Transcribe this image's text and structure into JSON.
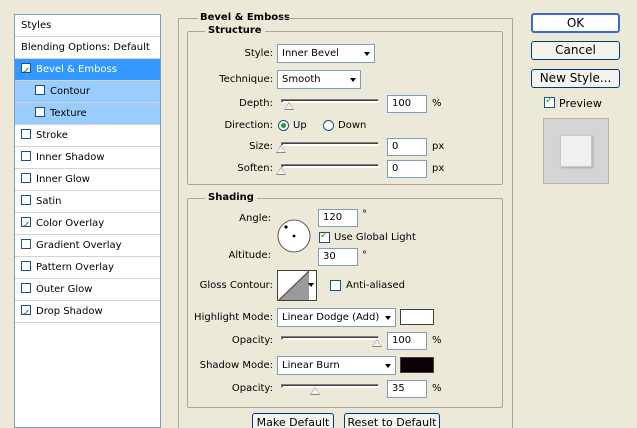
{
  "styles_panel": {
    "header": "Styles",
    "blending_options": "Blending Options: Default",
    "items": [
      {
        "label": "Bevel & Emboss",
        "checked": true,
        "selected": true,
        "sub": false
      },
      {
        "label": "Contour",
        "checked": false,
        "selected": false,
        "sub": true
      },
      {
        "label": "Texture",
        "checked": false,
        "selected": false,
        "sub": true
      },
      {
        "label": "Stroke",
        "checked": false,
        "selected": false,
        "sub": false
      },
      {
        "label": "Inner Shadow",
        "checked": false,
        "selected": false,
        "sub": false
      },
      {
        "label": "Inner Glow",
        "checked": false,
        "selected": false,
        "sub": false
      },
      {
        "label": "Satin",
        "checked": false,
        "selected": false,
        "sub": false
      },
      {
        "label": "Color Overlay",
        "checked": true,
        "selected": false,
        "sub": false
      },
      {
        "label": "Gradient Overlay",
        "checked": false,
        "selected": false,
        "sub": false
      },
      {
        "label": "Pattern Overlay",
        "checked": false,
        "selected": false,
        "sub": false
      },
      {
        "label": "Outer Glow",
        "checked": false,
        "selected": false,
        "sub": false
      },
      {
        "label": "Drop Shadow",
        "checked": true,
        "selected": false,
        "sub": false
      }
    ]
  },
  "bevel": {
    "title": "Bevel & Emboss",
    "structure": {
      "title": "Structure",
      "style_label": "Style:",
      "style_value": "Inner Bevel",
      "technique_label": "Technique:",
      "technique_value": "Smooth",
      "depth_label": "Depth:",
      "depth_value": "100",
      "depth_unit": "%",
      "depth_slider": 0.08,
      "direction_label": "Direction:",
      "direction_up": "Up",
      "direction_down": "Down",
      "direction_selected": "Up",
      "size_label": "Size:",
      "size_value": "0",
      "size_unit": "px",
      "size_slider": 0.0,
      "soften_label": "Soften:",
      "soften_value": "0",
      "soften_unit": "px",
      "soften_slider": 0.0
    },
    "shading": {
      "title": "Shading",
      "angle_label": "Angle:",
      "angle_value": "120",
      "degree_symbol": "°",
      "use_global_light_label": "Use Global Light",
      "use_global_light": true,
      "altitude_label": "Altitude:",
      "altitude_value": "30",
      "gloss_contour_label": "Gloss Contour:",
      "anti_aliased_label": "Anti-aliased",
      "anti_aliased": false,
      "highlight_mode_label": "Highlight Mode:",
      "highlight_mode_value": "Linear Dodge (Add)",
      "highlight_color": "#ffffff",
      "highlight_opacity_label": "Opacity:",
      "highlight_opacity_value": "100",
      "highlight_opacity_slider": 1.0,
      "shadow_mode_label": "Shadow Mode:",
      "shadow_mode_value": "Linear Burn",
      "shadow_color": "#0a0006",
      "shadow_opacity_label": "Opacity:",
      "shadow_opacity_value": "35",
      "shadow_opacity_slider": 0.35,
      "percent": "%"
    },
    "make_default": "Make Default",
    "reset_default": "Reset to Default"
  },
  "right": {
    "ok": "OK",
    "cancel": "Cancel",
    "new_style": "New Style...",
    "preview_label": "Preview",
    "preview_checked": true
  },
  "colors": {
    "dialog_bg": "#ece9d8",
    "selected_row": "#3399ff",
    "sub_row": "#99ccff"
  }
}
